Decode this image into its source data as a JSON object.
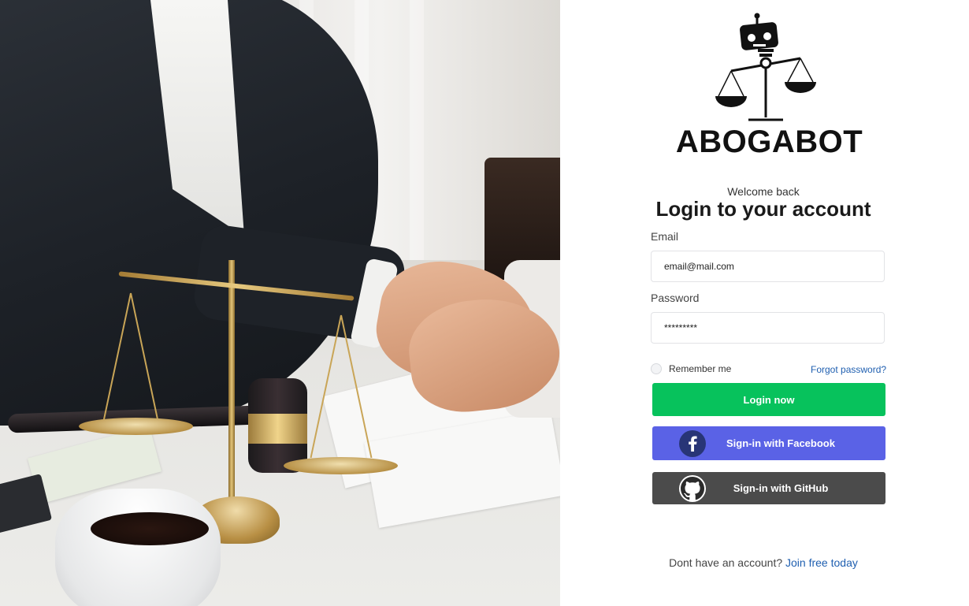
{
  "brand": {
    "name": "ABOGABOT"
  },
  "login": {
    "welcome": "Welcome back",
    "title": "Login to your account",
    "email_label": "Email",
    "email_value": "email@mail.com",
    "password_label": "Password",
    "password_value": "*********",
    "remember_label": "Remember me",
    "remember_checked": false,
    "forgot_label": "Forgot password?",
    "submit_label": "Login now",
    "facebook_label": "Sign-in with Facebook",
    "github_label": "Sign-in with GitHub",
    "signup_prompt": "Dont have an account?",
    "signup_link": "Join free today"
  },
  "colors": {
    "primary_green": "#07c25c",
    "facebook_blue": "#5a62e6",
    "github_gray": "#4b4b4b",
    "link_blue": "#1f5fb0"
  },
  "icons": {
    "logo": "robot-scales-logo",
    "facebook": "facebook-icon",
    "github": "github-icon"
  }
}
